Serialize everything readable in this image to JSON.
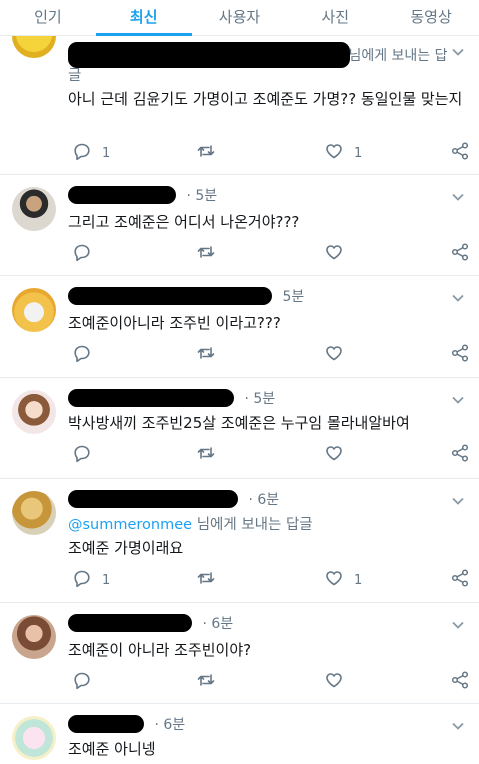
{
  "tabs": [
    {
      "label": "인기"
    },
    {
      "label": "최신",
      "active": true
    },
    {
      "label": "사용자"
    },
    {
      "label": "사진"
    },
    {
      "label": "동영상"
    }
  ],
  "colors": {
    "accent": "#1da1f2",
    "secondary": "#657786",
    "divider": "#e6ecf0",
    "redaction": "#000000"
  },
  "tweets": [
    {
      "header_visible": "님에게 보내는 답",
      "reply_to_tail": "글",
      "text": "아니 근데 김윤기도 가명이고 조예준도 가명?? 동일인물 맞는지",
      "reply_count": "1",
      "like_count": "1"
    },
    {
      "time": "· 5분",
      "text": "그리고 조예준은 어디서 나온거야???",
      "reply_count": "",
      "like_count": ""
    },
    {
      "time": "5분",
      "text": "조예준이아니라 조주빈 이라고???",
      "reply_count": "",
      "like_count": ""
    },
    {
      "time": "· 5분",
      "text": "박사방새끼 조주빈25살 조예준은 누구임 몰라내알바여",
      "reply_count": "",
      "like_count": ""
    },
    {
      "time": "· 6분",
      "reply_handle": "@summeronmee",
      "reply_suffix": " 님에게 보내는 답글",
      "text": "조예준 가명이래요",
      "reply_count": "1",
      "like_count": "1"
    },
    {
      "time": "· 6분",
      "text": "조예준이 아니라 조주빈이야?",
      "reply_count": "",
      "like_count": ""
    },
    {
      "time": "· 6분",
      "text": "조예준 아니넹",
      "reply_count": "",
      "like_count": ""
    }
  ]
}
